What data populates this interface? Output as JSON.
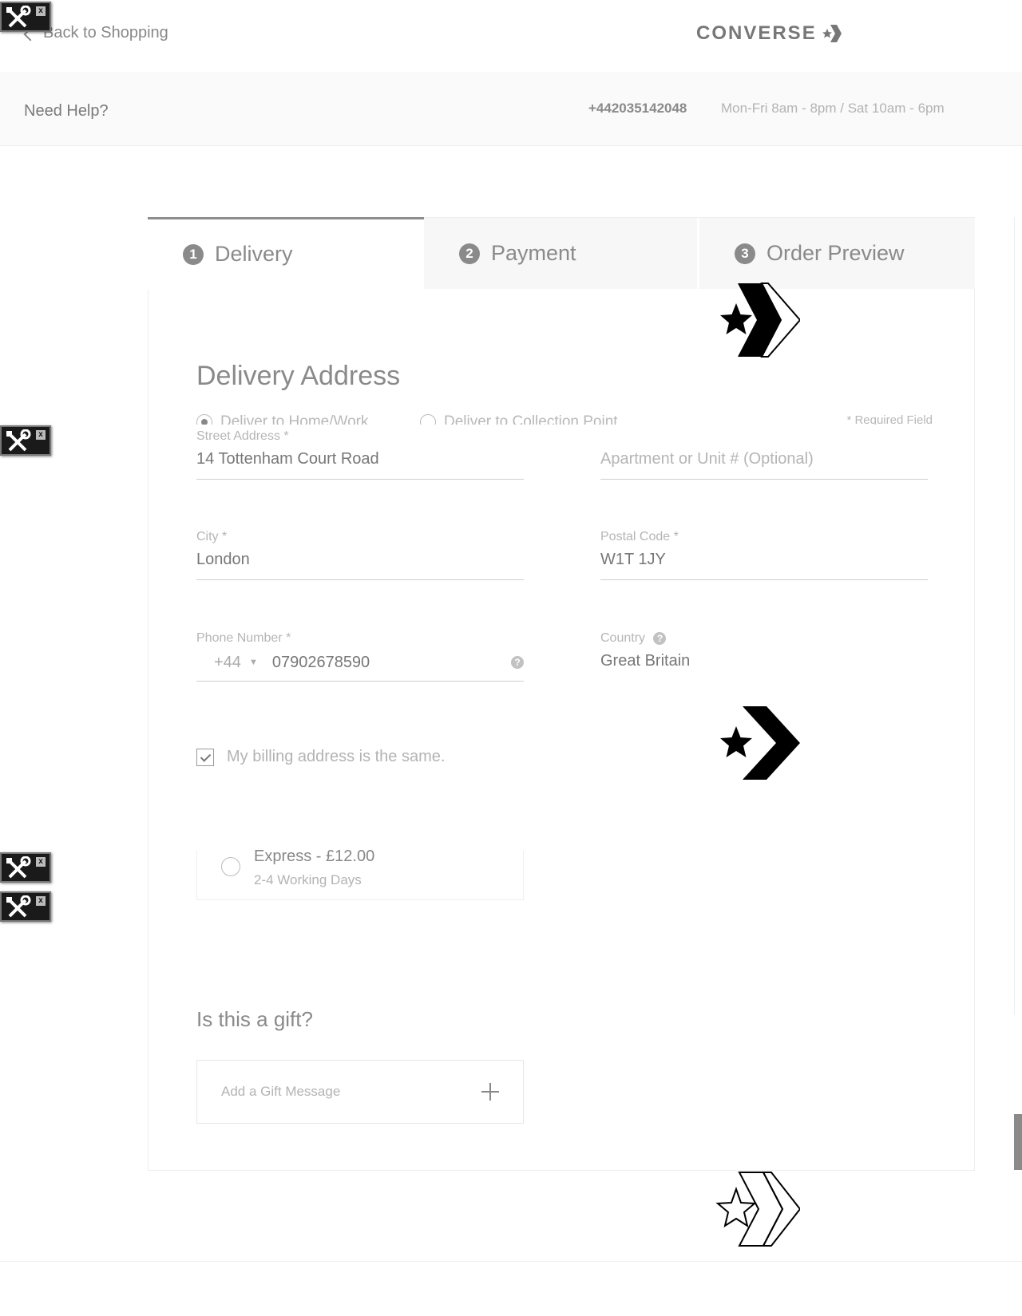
{
  "header": {
    "back_label": "Back to Shopping",
    "logo_text": "CONVERSE"
  },
  "help": {
    "title": "Need Help?",
    "phone": "+442035142048",
    "hours": "Mon-Fri 8am - 8pm / Sat 10am - 6pm"
  },
  "steps": [
    {
      "num": "1",
      "label": "Delivery"
    },
    {
      "num": "2",
      "label": "Payment"
    },
    {
      "num": "3",
      "label": "Order Preview"
    }
  ],
  "delivery": {
    "title": "Delivery Address",
    "option_home": "Deliver to Home/Work",
    "option_collection": "Deliver to Collection Point",
    "required_note": "* Required Field",
    "street": {
      "label": "Street Address *",
      "value": "14 Tottenham Court Road"
    },
    "apartment": {
      "placeholder": "Apartment or Unit # (Optional)"
    },
    "city": {
      "label": "City *",
      "value": "London"
    },
    "postal": {
      "label": "Postal Code *",
      "value": "W1T 1JY"
    },
    "phone": {
      "label": "Phone Number *",
      "prefix": "+44",
      "value": "07902678590"
    },
    "country": {
      "label": "Country",
      "value": "Great Britain"
    },
    "billing_same": "My billing address is the same."
  },
  "shipping": {
    "name": "Express - £12.00",
    "days": "2-4 Working Days"
  },
  "gift": {
    "title": "Is this a gift?",
    "add_message": "Add a Gift Message"
  },
  "icons": {
    "help": "?",
    "close": "x"
  }
}
